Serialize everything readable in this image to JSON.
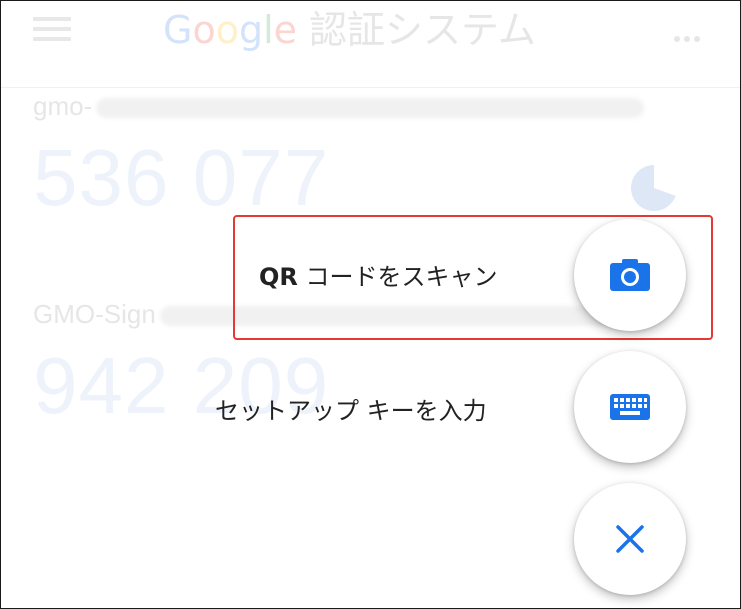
{
  "appbar": {
    "brand_letters": [
      "G",
      "o",
      "o",
      "g",
      "l",
      "e"
    ],
    "title_rest": "認証システム",
    "menu_icon": "hamburger-menu-icon",
    "overflow_icon": "more-horizontal-icon"
  },
  "accounts": [
    {
      "issuer": "gmo-",
      "code": "536 077"
    },
    {
      "issuer": "GMO-Sign",
      "code": "942 209"
    }
  ],
  "speed_dial": {
    "scan_qr": {
      "label_prefix": "QR",
      "label_rest": "コードをスキャン",
      "icon": "camera-icon"
    },
    "setup_key": {
      "label": "セットアップ キーを入力",
      "icon": "keyboard-icon"
    },
    "close": {
      "icon": "close-icon"
    }
  },
  "colors": {
    "accent": "#1a73e8",
    "highlight": "#e53935"
  }
}
